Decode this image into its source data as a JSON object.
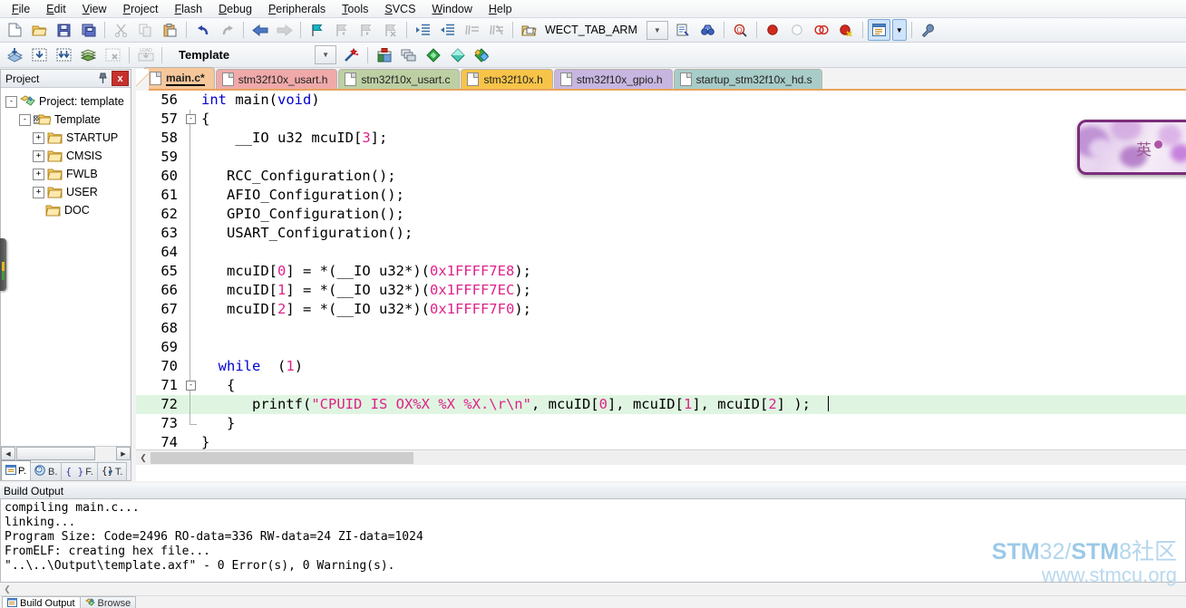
{
  "menu": {
    "items": [
      "File",
      "Edit",
      "View",
      "Project",
      "Flash",
      "Debug",
      "Peripherals",
      "Tools",
      "SVCS",
      "Window",
      "Help"
    ]
  },
  "toolbar_main": {
    "buttons": [
      {
        "name": "new-file",
        "icon": "new-file-icon",
        "enabled": true
      },
      {
        "name": "open-file",
        "icon": "open-folder-icon",
        "enabled": true
      },
      {
        "name": "save",
        "icon": "floppy-save-icon",
        "enabled": true
      },
      {
        "name": "save-all",
        "icon": "save-all-icon",
        "enabled": true
      },
      {
        "name": "cut",
        "icon": "scissors-icon",
        "enabled": false
      },
      {
        "name": "copy",
        "icon": "copy-icon",
        "enabled": false
      },
      {
        "name": "paste",
        "icon": "clipboard-paste-icon",
        "enabled": true
      },
      {
        "name": "undo",
        "icon": "undo-arrow-icon",
        "enabled": true
      },
      {
        "name": "redo",
        "icon": "redo-arrow-icon",
        "enabled": false
      },
      {
        "name": "navigate-back",
        "icon": "arrow-left-icon",
        "enabled": true
      },
      {
        "name": "navigate-forward",
        "icon": "arrow-right-icon",
        "enabled": false
      },
      {
        "name": "bookmark-toggle",
        "icon": "bookmark-flag-icon",
        "enabled": true
      },
      {
        "name": "bookmark-prev",
        "icon": "bookmark-prev-icon",
        "enabled": false
      },
      {
        "name": "bookmark-next",
        "icon": "bookmark-next-icon",
        "enabled": false
      },
      {
        "name": "bookmark-clear",
        "icon": "bookmark-clear-icon",
        "enabled": false
      },
      {
        "name": "indent",
        "icon": "indent-right-icon",
        "enabled": true
      },
      {
        "name": "outdent",
        "icon": "indent-left-icon",
        "enabled": true
      },
      {
        "name": "comment-lines",
        "icon": "comment-icon",
        "enabled": false
      },
      {
        "name": "uncomment-lines",
        "icon": "uncomment-icon",
        "enabled": false
      },
      {
        "name": "open-project-folder",
        "icon": "open-project-icon",
        "enabled": true
      }
    ],
    "find_target_label": "WECT_TAB_ARM",
    "find_buttons": [
      {
        "name": "find-in-files",
        "icon": "find-in-files-icon"
      },
      {
        "name": "incremental-find",
        "icon": "binoculars-icon"
      },
      {
        "name": "find-symbol",
        "icon": "magnify-q-icon"
      }
    ],
    "debug_buttons": [
      {
        "name": "insert-breakpoint",
        "icon": "breakpoint-red-dot-icon"
      },
      {
        "name": "disable-breakpoint",
        "icon": "breakpoint-hollow-icon"
      },
      {
        "name": "disable-all-breakpoints",
        "icon": "breakpoints-disable-icon"
      },
      {
        "name": "kill-all-breakpoints",
        "icon": "breakpoint-kill-icon"
      }
    ],
    "window_buttons": [
      {
        "name": "manage-windows",
        "icon": "window-layout-icon",
        "active": true
      },
      {
        "name": "window-dropdown",
        "icon": "chevron-down-icon"
      },
      {
        "name": "configuration-wizard",
        "icon": "wrench-icon"
      }
    ]
  },
  "toolbar_build": {
    "buttons": [
      {
        "name": "translate-file",
        "icon": "translate-icon",
        "enabled": true
      },
      {
        "name": "build-target",
        "icon": "build-icon",
        "enabled": true
      },
      {
        "name": "rebuild-all",
        "icon": "rebuild-all-icon",
        "enabled": true
      },
      {
        "name": "batch-build",
        "icon": "batch-build-icon",
        "enabled": true
      },
      {
        "name": "stop-build",
        "icon": "stop-build-icon",
        "enabled": false
      },
      {
        "name": "download-to-flash",
        "icon": "load-flash-icon",
        "enabled": false
      }
    ],
    "target_value": "Template",
    "after_buttons": [
      {
        "name": "target-options",
        "icon": "magic-wand-icon",
        "enabled": true
      },
      {
        "name": "options-for-target",
        "icon": "options-target-icon",
        "enabled": true
      },
      {
        "name": "manage-project-items",
        "icon": "manage-components-icon",
        "enabled": true
      },
      {
        "name": "pack-installer",
        "icon": "green-diamond-icon",
        "enabled": true
      },
      {
        "name": "manage-run-time-env",
        "icon": "teal-diamond-icon",
        "enabled": true
      },
      {
        "name": "select-software-packs",
        "icon": "multi-diamond-icon",
        "enabled": true
      }
    ]
  },
  "project_panel": {
    "title": "Project",
    "pin_icon": "pin-icon",
    "close_icon": "close-icon",
    "tree": [
      {
        "label": "Project: template",
        "depth": 0,
        "expander": "-",
        "icon": "project-icon"
      },
      {
        "label": "Template",
        "depth": 1,
        "expander": "-",
        "icon": "target-folder-icon"
      },
      {
        "label": "STARTUP",
        "depth": 2,
        "expander": "+",
        "icon": "folder-icon"
      },
      {
        "label": "CMSIS",
        "depth": 2,
        "expander": "+",
        "icon": "folder-icon"
      },
      {
        "label": "FWLB",
        "depth": 2,
        "expander": "+",
        "icon": "folder-icon"
      },
      {
        "label": "USER",
        "depth": 2,
        "expander": "+",
        "icon": "folder-icon"
      },
      {
        "label": "DOC",
        "depth": 2,
        "expander": "",
        "icon": "folder-icon"
      }
    ],
    "tabs": [
      {
        "label": "P.",
        "icon": "project-tab-icon",
        "selected": true
      },
      {
        "label": "B.",
        "icon": "books-tab-icon",
        "selected": false
      },
      {
        "label": "F.",
        "icon": "functions-tab-icon",
        "selected": false
      },
      {
        "label": "T.",
        "icon": "templates-tab-icon",
        "selected": false
      }
    ]
  },
  "editor": {
    "tabs": [
      {
        "label": "main.c*",
        "color": "#f6c79a",
        "selected": true
      },
      {
        "label": "stm32f10x_usart.h",
        "color": "#f0a9a9",
        "selected": false
      },
      {
        "label": "stm32f10x_usart.c",
        "color": "#bdd0a3",
        "selected": false
      },
      {
        "label": "stm32f10x.h",
        "color": "#f7c449",
        "selected": false
      },
      {
        "label": "stm32f10x_gpio.h",
        "color": "#c7b6e0",
        "selected": false
      },
      {
        "label": "startup_stm32f10x_hd.s",
        "color": "#a8ccc8",
        "selected": false
      }
    ],
    "first_line": 56,
    "highlight_line": 72,
    "lines": [
      {
        "n": 56,
        "fold": "",
        "tokens": [
          {
            "t": "int ",
            "c": "kw"
          },
          {
            "t": "main(",
            "c": "pun"
          },
          {
            "t": "void",
            "c": "kw"
          },
          {
            "t": ")",
            "c": "pun"
          }
        ]
      },
      {
        "n": 57,
        "fold": "box-open",
        "tokens": [
          {
            "t": "{",
            "c": "pun"
          }
        ]
      },
      {
        "n": 58,
        "fold": "line",
        "tokens": [
          {
            "t": "    __IO u32 mcuID[",
            "c": "pun"
          },
          {
            "t": "3",
            "c": "num"
          },
          {
            "t": "];",
            "c": "pun"
          }
        ]
      },
      {
        "n": 59,
        "fold": "line",
        "tokens": [
          {
            "t": "",
            "c": "pun"
          }
        ]
      },
      {
        "n": 60,
        "fold": "line",
        "tokens": [
          {
            "t": "   RCC_Configuration();",
            "c": "pun"
          }
        ]
      },
      {
        "n": 61,
        "fold": "line",
        "tokens": [
          {
            "t": "   AFIO_Configuration();",
            "c": "pun"
          }
        ]
      },
      {
        "n": 62,
        "fold": "line",
        "tokens": [
          {
            "t": "   GPIO_Configuration();",
            "c": "pun"
          }
        ]
      },
      {
        "n": 63,
        "fold": "line",
        "tokens": [
          {
            "t": "   USART_Configuration();",
            "c": "pun"
          }
        ]
      },
      {
        "n": 64,
        "fold": "line",
        "tokens": [
          {
            "t": "",
            "c": "pun"
          }
        ]
      },
      {
        "n": 65,
        "fold": "line",
        "tokens": [
          {
            "t": "   mcuID[",
            "c": "pun"
          },
          {
            "t": "0",
            "c": "num"
          },
          {
            "t": "] = *(__IO u32*)(",
            "c": "pun"
          },
          {
            "t": "0x1FFFF7E8",
            "c": "num"
          },
          {
            "t": ");",
            "c": "pun"
          }
        ]
      },
      {
        "n": 66,
        "fold": "line",
        "tokens": [
          {
            "t": "   mcuID[",
            "c": "pun"
          },
          {
            "t": "1",
            "c": "num"
          },
          {
            "t": "] = *(__IO u32*)(",
            "c": "pun"
          },
          {
            "t": "0x1FFFF7EC",
            "c": "num"
          },
          {
            "t": ");",
            "c": "pun"
          }
        ]
      },
      {
        "n": 67,
        "fold": "line",
        "tokens": [
          {
            "t": "   mcuID[",
            "c": "pun"
          },
          {
            "t": "2",
            "c": "num"
          },
          {
            "t": "] = *(__IO u32*)(",
            "c": "pun"
          },
          {
            "t": "0x1FFFF7F0",
            "c": "num"
          },
          {
            "t": ");",
            "c": "pun"
          }
        ]
      },
      {
        "n": 68,
        "fold": "line",
        "tokens": [
          {
            "t": "",
            "c": "pun"
          }
        ]
      },
      {
        "n": 69,
        "fold": "line",
        "tokens": [
          {
            "t": "",
            "c": "pun"
          }
        ]
      },
      {
        "n": 70,
        "fold": "line",
        "tokens": [
          {
            "t": "  ",
            "c": "pun"
          },
          {
            "t": "while",
            "c": "kw"
          },
          {
            "t": "  (",
            "c": "pun"
          },
          {
            "t": "1",
            "c": "num"
          },
          {
            "t": ")",
            "c": "pun"
          }
        ]
      },
      {
        "n": 71,
        "fold": "box-open",
        "tokens": [
          {
            "t": "   {",
            "c": "pun"
          }
        ]
      },
      {
        "n": 72,
        "fold": "line",
        "tokens": [
          {
            "t": "      printf(",
            "c": "pun"
          },
          {
            "t": "\"CPUID IS OX%X %X %X.\\r\\n\"",
            "c": "str"
          },
          {
            "t": ", mcuID[",
            "c": "pun"
          },
          {
            "t": "0",
            "c": "num"
          },
          {
            "t": "], mcuID[",
            "c": "pun"
          },
          {
            "t": "1",
            "c": "num"
          },
          {
            "t": "], mcuID[",
            "c": "pun"
          },
          {
            "t": "2",
            "c": "num"
          },
          {
            "t": "] );  ",
            "c": "pun"
          }
        ]
      },
      {
        "n": 73,
        "fold": "end",
        "tokens": [
          {
            "t": "   }",
            "c": "pun"
          }
        ]
      },
      {
        "n": 74,
        "fold": "",
        "tokens": [
          {
            "t": "}",
            "c": "pun"
          }
        ]
      }
    ]
  },
  "build_output": {
    "title": "Build Output",
    "lines": [
      "compiling main.c...",
      "linking...",
      "Program Size: Code=2496 RO-data=336 RW-data=24 ZI-data=1024",
      "FromELF: creating hex file...",
      "\"..\\..\\Output\\template.axf\" - 0 Error(s), 0 Warning(s)."
    ],
    "tabs": [
      {
        "label": "Build Output",
        "icon": "build-output-icon",
        "selected": true
      },
      {
        "label": "Browse",
        "icon": "browse-icon",
        "selected": false
      }
    ]
  },
  "ime_bar": {
    "mode_label": "英",
    "border_color": "#7b2d7b"
  },
  "watermark": {
    "line1_a": "STM",
    "line1_b": "32/",
    "line1_c": "STM",
    "line1_d": "8社区",
    "line2": "www.stmcu.org",
    "color": "#9cc9e8"
  }
}
